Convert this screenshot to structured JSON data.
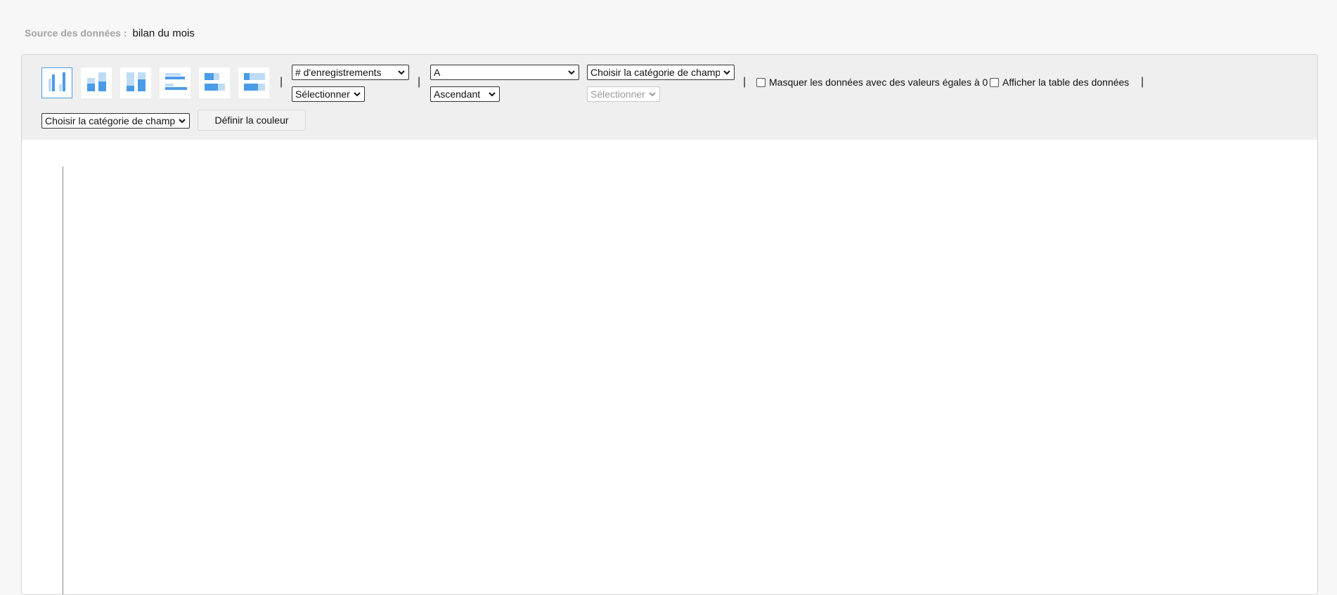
{
  "source": {
    "label": "Source des données :",
    "value": "bilan du mois"
  },
  "chart_types": [
    {
      "name": "grouped-vertical-bars",
      "selected": true
    },
    {
      "name": "stacked-vertical-bars",
      "selected": false
    },
    {
      "name": "percent-vertical-bars",
      "selected": false
    },
    {
      "name": "grouped-horizontal-bars",
      "selected": false
    },
    {
      "name": "stacked-horizontal-bars",
      "selected": false
    },
    {
      "name": "percent-horizontal-bars",
      "selected": false
    }
  ],
  "controls": {
    "measure": {
      "value": "# d'enregistrements"
    },
    "measure_field": {
      "value": "Sélectionner"
    },
    "group_by": {
      "value": "A"
    },
    "sort_order": {
      "value": "Ascendant"
    },
    "category": {
      "value": "Choisir la catégorie de champ"
    },
    "category_field": {
      "value": "Sélectionner",
      "disabled": true
    },
    "hide_zero": {
      "label": "Masquer les données avec des valeurs égales à 0",
      "checked": false
    },
    "show_table": {
      "label": "Afficher la table des données",
      "checked": false
    },
    "color_category": {
      "value": "Choisir la catégorie de champ"
    },
    "set_color_button": "Définir la couleur",
    "separator": "|"
  },
  "colors": {
    "accent": "#4a9be8",
    "bar_dark": "#4a9be8",
    "bar_light": "#bfdcf7",
    "toolbar_bg": "#efefef"
  }
}
